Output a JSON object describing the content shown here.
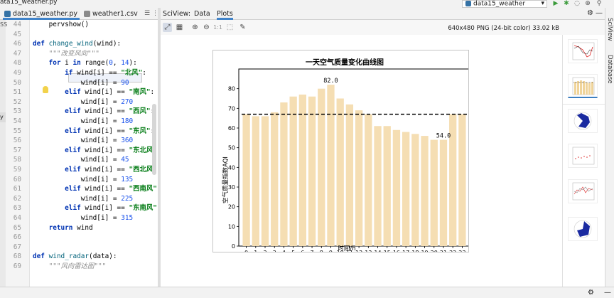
{
  "window": {
    "project_file": "ata15_weather.py"
  },
  "run_config": {
    "label": "data15_weather"
  },
  "editor_tabs": [
    {
      "label": "data15_weather.py"
    },
    {
      "label": "weather1.csv"
    }
  ],
  "edge_text": {
    "top": "SS",
    "mid": "y"
  },
  "code_lines": [
    {
      "n": "44",
      "html": "    <span>pervshow()</span>"
    },
    {
      "n": "45",
      "html": ""
    },
    {
      "n": "46",
      "html": "<span class=\"kw\">def</span> <span class=\"fn\">change_wind</span>(wind):"
    },
    {
      "n": "47",
      "html": "    <span class=\"doc\">\"\"\"改变风向\"\"\"</span>"
    },
    {
      "n": "48",
      "html": "    <span class=\"kw\">for</span> i <span class=\"kw\">in</span> range(<span class=\"num\">0</span>, <span class=\"num\">14</span>):"
    },
    {
      "n": "49",
      "html": "        <span class=\"kw\">if</span> wind[i] == <span class=\"str\">\"北风\"</span>:"
    },
    {
      "n": "50",
      "html": "            wind[i] = <span class=\"num\">90</span>"
    },
    {
      "n": "51",
      "html": "        <span class=\"kw\">elif</span> wind[i] == <span class=\"str\">\"南风\"</span>:"
    },
    {
      "n": "52",
      "html": "            wind[i] = <span class=\"num\">270</span>"
    },
    {
      "n": "53",
      "html": "        <span class=\"kw\">elif</span> wind[i] == <span class=\"str\">\"西风\"</span>:"
    },
    {
      "n": "54",
      "html": "            wind[i] = <span class=\"num\">180</span>"
    },
    {
      "n": "55",
      "html": "        <span class=\"kw\">elif</span> wind[i] == <span class=\"str\">\"东风\"</span>:"
    },
    {
      "n": "56",
      "html": "            wind[i] = <span class=\"num\">360</span>"
    },
    {
      "n": "57",
      "html": "        <span class=\"kw\">elif</span> wind[i] == <span class=\"str\">\"东北风\"</span>:"
    },
    {
      "n": "58",
      "html": "            wind[i] = <span class=\"num\">45</span>"
    },
    {
      "n": "59",
      "html": "        <span class=\"kw\">elif</span> wind[i] == <span class=\"str\">\"西北风\"</span>:"
    },
    {
      "n": "60",
      "html": "            wind[i] = <span class=\"num\">135</span>"
    },
    {
      "n": "61",
      "html": "        <span class=\"kw\">elif</span> wind[i] == <span class=\"str\">\"西南风\"</span>:"
    },
    {
      "n": "62",
      "html": "            wind[i] = <span class=\"num\">225</span>"
    },
    {
      "n": "63",
      "html": "        <span class=\"kw\">elif</span> wind[i] == <span class=\"str\">\"东南风\"</span>:"
    },
    {
      "n": "64",
      "html": "            wind[i] = <span class=\"num\">315</span>"
    },
    {
      "n": "65",
      "html": "    <span class=\"kw\">return</span> wind"
    },
    {
      "n": "66",
      "html": ""
    },
    {
      "n": "67",
      "html": ""
    },
    {
      "n": "68",
      "html": "<span class=\"kw\">def</span> <span class=\"fn\">wind_radar</span>(data):"
    },
    {
      "n": "69",
      "html": "    <span class=\"doc\">\"\"\"风向雷达图\"\"\"</span>"
    }
  ],
  "sciview": {
    "title": "SciView:",
    "tabs": [
      {
        "label": "Data"
      },
      {
        "label": "Plots"
      }
    ],
    "active_tab": "Plots",
    "image_info": "640x480 PNG (24-bit color) 33.02 kB",
    "tools": [
      "fit-icon",
      "grid-icon",
      "zoom-in-icon",
      "zoom-out-icon",
      "actual-size-icon",
      "fit-screen-icon",
      "color-picker-icon"
    ],
    "actual_size_label": "1:1"
  },
  "side_labels": {
    "sciview": "SciView",
    "database": "Database"
  },
  "chart_data": {
    "type": "bar",
    "title": "一天空气质量变化曲线图",
    "xlabel": "时间/h",
    "ylabel": "空气质量指数AQI",
    "categories": [
      "0",
      "1",
      "2",
      "3",
      "4",
      "5",
      "6",
      "7",
      "8",
      "9",
      "10",
      "11",
      "12",
      "13",
      "14",
      "15",
      "16",
      "17",
      "18",
      "19",
      "20",
      "21",
      "22",
      "23"
    ],
    "values": [
      67,
      66,
      66,
      68,
      73,
      76,
      77,
      76,
      80,
      82,
      75,
      72,
      69,
      67,
      61,
      61,
      59,
      58,
      57,
      56,
      54,
      54,
      67,
      67
    ],
    "yticks": [
      0,
      10,
      20,
      30,
      40,
      50,
      60,
      70,
      80
    ],
    "ylim": [
      0,
      90
    ],
    "mean_line": 67,
    "annotations": [
      {
        "x": "9",
        "text": "82.0"
      },
      {
        "x": "21",
        "text": "54.0"
      }
    ],
    "bar_color": "#f5deb3",
    "mean_line_color": "#000000",
    "grid": false
  }
}
